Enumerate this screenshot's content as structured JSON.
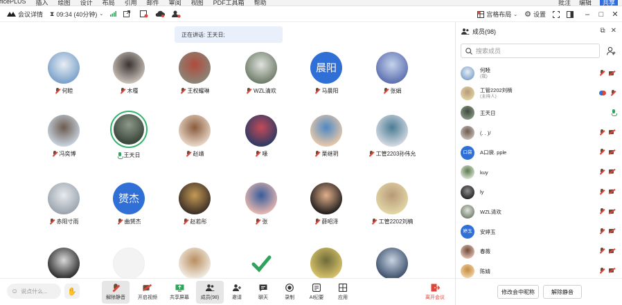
{
  "ribbon": {
    "menu": [
      "ficePLUS",
      "插入",
      "绘图",
      "设计",
      "布局",
      "引用",
      "邮件",
      "审阅",
      "视图",
      "PDF工具箱",
      "帮助"
    ],
    "right": [
      "批注",
      "编辑",
      "共享"
    ]
  },
  "topbar": {
    "meeting_details": "会议详情",
    "time": "09:34 (40分钟)",
    "layout": "宫格布局",
    "settings": "设置"
  },
  "speaking": "正在讲话: 王天日;",
  "tiles": [
    {
      "name": "何睦",
      "mic": "off",
      "colors": [
        "#7aa0c8",
        "#e8eef5"
      ]
    },
    {
      "name": "木槿",
      "mic": "off",
      "colors": [
        "#c9c0b8",
        "#3a3431"
      ]
    },
    {
      "name": "王权耀琳",
      "mic": "off",
      "colors": [
        "#8a8678",
        "#b04b3d"
      ]
    },
    {
      "name": "WZL清欢",
      "mic": "off",
      "colors": [
        "#6e7b6a",
        "#dfe3dc"
      ]
    },
    {
      "name": "马晨阳",
      "mic": "off",
      "avatar_text": "晨阳"
    },
    {
      "name": "张娟",
      "mic": "off",
      "colors": [
        "#5d6fb0",
        "#c4d3ec"
      ]
    },
    {
      "name": "冯奕博",
      "mic": "off",
      "colors": [
        "#c8d3df",
        "#6c5b50"
      ]
    },
    {
      "name": "王天日",
      "mic": "on",
      "speaking": true
    },
    {
      "name": "赵靖",
      "mic": "off",
      "colors": [
        "#e8d8c8",
        "#8a5b3c"
      ]
    },
    {
      "name": "喙",
      "mic": "off",
      "colors": [
        "#2c3b63",
        "#c44a58"
      ]
    },
    {
      "name": "栗继玥",
      "mic": "off",
      "colors": [
        "#e9c9a9",
        "#4e88c4"
      ]
    },
    {
      "name": "工管2203孙伟允",
      "mic": "off",
      "colors": [
        "#d4d9e2",
        "#4b7c94"
      ]
    },
    {
      "name": "赤阳寸雨",
      "mic": "off",
      "colors": [
        "#9aa3ad",
        "#e8ebee"
      ]
    },
    {
      "name": "曲赟杰",
      "mic": "off",
      "avatar_text": "赟杰"
    },
    {
      "name": "赵若彤",
      "mic": "off",
      "colors": [
        "#3a2e26",
        "#c59a55"
      ]
    },
    {
      "name": "张",
      "mic": "off",
      "colors": [
        "#e7b7b0",
        "#385c9a"
      ]
    },
    {
      "name": "薛昭泽",
      "mic": "off",
      "colors": [
        "#1f1c1c",
        "#e2b08b"
      ]
    },
    {
      "name": "工管2202刘楠",
      "mic": "off",
      "colors": [
        "#e2d7a6",
        "#b89a79"
      ]
    },
    {
      "name": "",
      "colors": [
        "#2a2a2a",
        "#d9d9d9"
      ]
    },
    {
      "name": "",
      "colors": [
        "#f3f3f3",
        "#f3f3f3"
      ]
    },
    {
      "name": "",
      "colors": [
        "#f2ede4",
        "#b98e5f"
      ]
    },
    {
      "name": "",
      "colors": [
        "#ffffff",
        "#2ea35c"
      ]
    },
    {
      "name": "",
      "colors": [
        "#d9c46a",
        "#6f6a3a"
      ]
    },
    {
      "name": "",
      "colors": [
        "#3b4f6b",
        "#c8d3e2"
      ]
    }
  ],
  "bottombar": {
    "chat_placeholder": "说点什么...",
    "buttons": [
      "解除静音",
      "开启视频",
      "共享屏幕",
      "成员(98)",
      "邀请",
      "聊天",
      "录制",
      "AI纪要",
      "应用"
    ],
    "leave": "离开会议"
  },
  "panel": {
    "title": "成员(98)",
    "search_placeholder": "搜索成员",
    "members": [
      {
        "name": "何睦",
        "sub": "(我)",
        "colors": [
          "#7aa0c8",
          "#e8eef5"
        ],
        "state": "muted"
      },
      {
        "name": "工管2202刘楠",
        "sub": "(主持人)",
        "colors": [
          "#e2d7a6",
          "#b89a79"
        ],
        "state": "host"
      },
      {
        "name": "王天日",
        "sub": "",
        "colors": [
          "#8c9a8a",
          "#3f4a3e"
        ],
        "state": "speaking"
      },
      {
        "name": "(. . )/",
        "sub": "",
        "colors": [
          "#c9c0b8",
          "#6c5b50"
        ],
        "state": "muted"
      },
      {
        "name": "A口袋. pple",
        "sub": "",
        "avatar_text": "口袋",
        "state": "muted"
      },
      {
        "name": "kuy",
        "sub": "",
        "colors": [
          "#dfe6d6",
          "#5a7a4f"
        ],
        "state": "muted"
      },
      {
        "name": "ly",
        "sub": "",
        "colors": [
          "#1f1f1f",
          "#8f8f8f"
        ],
        "state": "muted"
      },
      {
        "name": "WZL清欢",
        "sub": "",
        "colors": [
          "#6e7b6a",
          "#dfe3dc"
        ],
        "state": "muted"
      },
      {
        "name": "安婷玉",
        "sub": "",
        "avatar_text": "婷玉",
        "state": "muted"
      },
      {
        "name": "春薇",
        "sub": "",
        "colors": [
          "#e8c4b8",
          "#6e4a3a"
        ],
        "state": "muted"
      },
      {
        "name": "陈婧",
        "sub": "",
        "colors": [
          "#f2d7a8",
          "#c58a43"
        ],
        "state": "muted"
      }
    ],
    "footer_buttons": [
      "修改会中昵称",
      "解除静音"
    ]
  }
}
